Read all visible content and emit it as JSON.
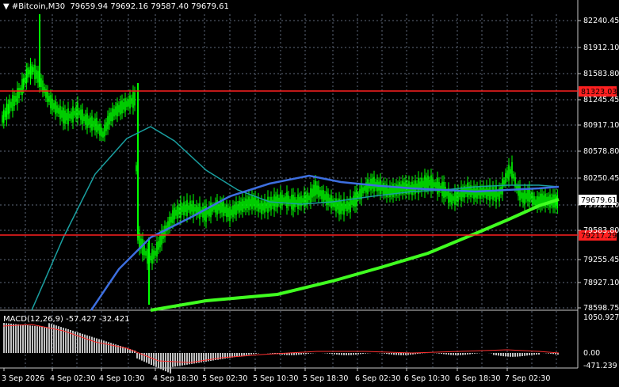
{
  "window": {
    "symbol": "#Bitcoin,M30",
    "ohlc": "79659.94 79692.16 79587.40 79679.61",
    "menu_arrow": "triangle-down-icon"
  },
  "price_axis": {
    "labels": [
      "82240.45",
      "81912.10",
      "81583.80",
      "81245.45",
      "80917.10",
      "80578.80",
      "80250.45",
      "79922.10",
      "79583.80",
      "79255.45",
      "78927.10",
      "78598.75"
    ]
  },
  "current_price": "79679.61",
  "levels": [
    {
      "name": "resistance",
      "label": "81323.03",
      "color": "#ff2020"
    },
    {
      "name": "support",
      "label": "79217.29",
      "color": "#ff2020"
    }
  ],
  "indicator": {
    "title": "MACD(12,26,9) -57.427 -32.421",
    "axis_labels": [
      "1050.927",
      "0.00",
      "-471.239"
    ]
  },
  "time_axis": {
    "labels": [
      "3 Sep 2026",
      "4 Sep 02:30",
      "4 Sep 10:30",
      "4 Sep 18:30",
      "5 Sep 02:30",
      "5 Sep 10:30",
      "5 Sep 18:30",
      "6 Sep 02:30",
      "6 Sep 10:30",
      "6 Sep 18:30",
      "7 Sep 02:30"
    ]
  },
  "colors": {
    "candles": "#00ff00",
    "ma_fast": "#1a9fa0",
    "ma_mid": "#3d6fe0",
    "ma_slow": "#40ff20",
    "grid": "#606a7c",
    "macd_hist": "#c0c0c0",
    "macd_signal": "#ff3030"
  }
}
